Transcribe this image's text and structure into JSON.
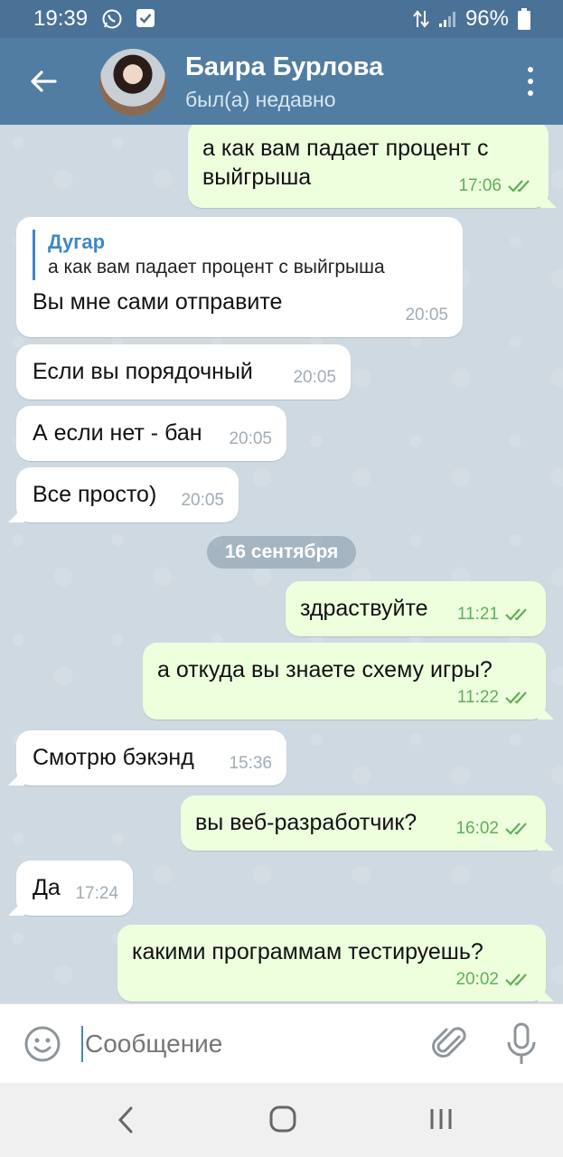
{
  "status_bar": {
    "time": "19:39",
    "battery": "96%",
    "icons": [
      "whatsapp-icon",
      "check-square-icon",
      "data-arrows-icon",
      "signal-icon",
      "battery-icon"
    ]
  },
  "header": {
    "name": "Баира Бурлова",
    "status": "был(а) недавно"
  },
  "messages": [
    {
      "dir": "out",
      "text": "а как вам падает процент с выйгрыша",
      "time": "17:06"
    },
    {
      "dir": "in",
      "reply_name": "Дугар",
      "reply_text": "а как вам падает процент с выйгрыша",
      "text": "Вы мне сами отправите",
      "time": "20:05"
    },
    {
      "dir": "in",
      "text": "Если вы порядочный",
      "time": "20:05"
    },
    {
      "dir": "in",
      "text": "А если нет - бан",
      "time": "20:05"
    },
    {
      "dir": "in",
      "text": "Все просто)",
      "time": "20:05"
    },
    {
      "dir": "out",
      "text": "здраствуйте",
      "time": "11:21"
    },
    {
      "dir": "out",
      "text": "а откуда вы знаете схему игры?",
      "time": "11:22"
    },
    {
      "dir": "in",
      "text": "Смотрю бэкэнд",
      "time": "15:36"
    },
    {
      "dir": "out",
      "text": "вы веб-разработчик?",
      "time": "16:02"
    },
    {
      "dir": "in",
      "text": "Да",
      "time": "17:24"
    },
    {
      "dir": "out",
      "text": "какими программам тестируешь?",
      "time": "20:02"
    }
  ],
  "date_separator": "16 сентября",
  "composer": {
    "placeholder": "Сообщение"
  },
  "colors": {
    "header": "#517da2",
    "statusbar": "#4a7296",
    "outgoing": "#eeffde",
    "incoming": "#ffffff",
    "check": "#5fae59",
    "accent": "#3e88c6"
  }
}
